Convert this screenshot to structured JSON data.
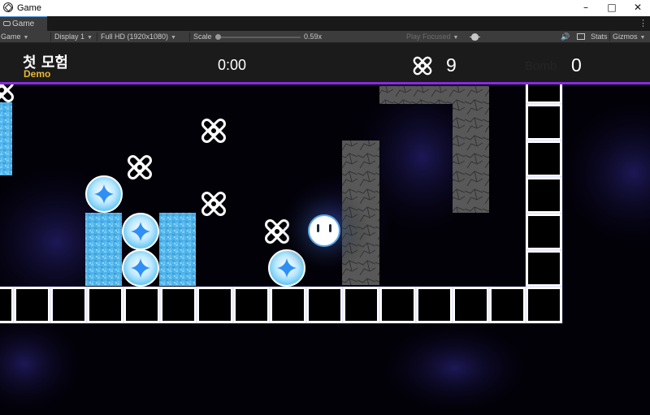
{
  "window": {
    "title": "Game"
  },
  "tab": {
    "label": "Game"
  },
  "toolbar": {
    "view_mode": "Game",
    "display": "Display 1",
    "resolution": "Full HD (1920x1080)",
    "scale_label": "Scale",
    "scale_value": "0.59x",
    "play_mode": "Play Focused",
    "stats_label": "Stats",
    "gizmos_label": "Gizmos"
  },
  "hud": {
    "level_title": "첫 모험",
    "level_subtitle": "Demo",
    "timer": "0:00",
    "x_count": "9",
    "bomb_label": "Bomb",
    "bomb_count": "0"
  },
  "colors": {
    "hud_accent": "#8a2be2",
    "level_subtitle": "#e8b830",
    "ice": "#4fb3ea",
    "orb": "#3aa8ff",
    "tile_glow": "#ffffff",
    "stone": "#5a5a5a"
  },
  "icons": [
    "close-icon",
    "maximize-icon",
    "minimize-icon",
    "bug-icon",
    "audio-icon",
    "x-cross-icon"
  ]
}
